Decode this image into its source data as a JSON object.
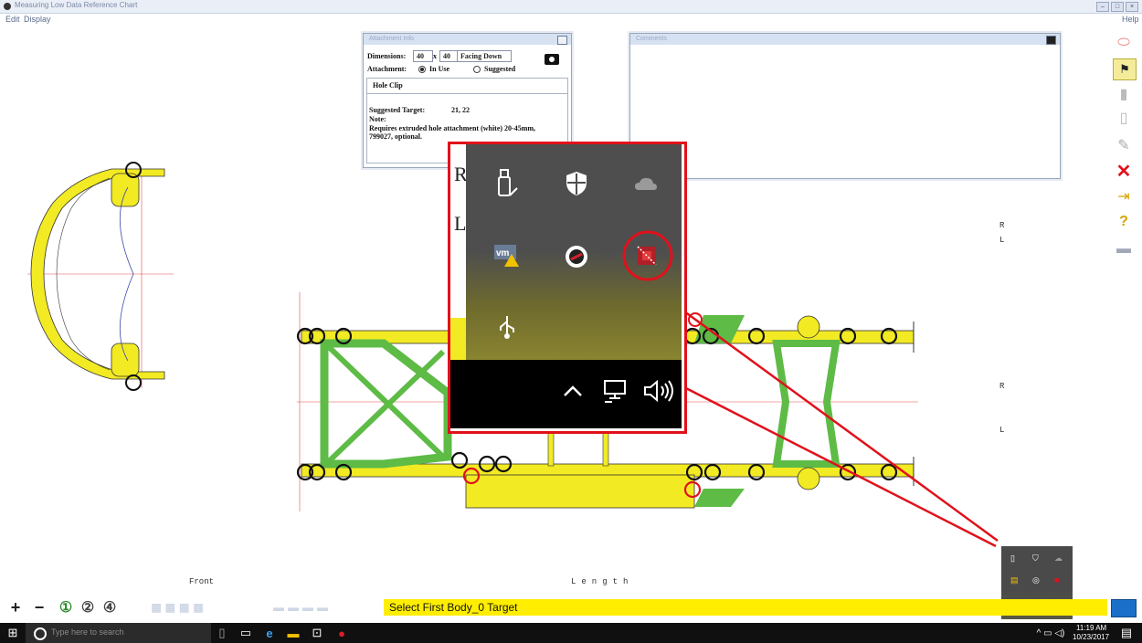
{
  "window": {
    "title": "Measuring Low Data Reference Chart"
  },
  "menu": [
    "Edit",
    "Display"
  ],
  "help_menu": "Help",
  "attachment_panel": {
    "header": "Attachment Info",
    "dimensions_label": "Dimensions:",
    "dim_w": "40",
    "dim_x": "x",
    "dim_h": "40",
    "facing": "Facing Down",
    "attachment_label": "Attachment:",
    "in_use_label": "In Use",
    "suggested_label": "Suggested",
    "item_name": "Hole Clip",
    "suggested_target_label": "Suggested Target:",
    "suggested_target_value": "21, 22",
    "note_label": "Note:",
    "note_text": "Requires extruded hole attachment (white) 20-45mm, 799027, optional."
  },
  "comments_panel": {
    "header": "Comments"
  },
  "side_labels": {
    "r_top": "R",
    "l_top": "L",
    "r_bottom": "R",
    "l_bottom": "L",
    "front": "Front",
    "length": "Length"
  },
  "status": {
    "message": "Select First Body_0 Target"
  },
  "taskbar": {
    "search_placeholder": "Type here to search",
    "time": "11:19 AM",
    "date": "10/23/2017"
  },
  "popup_letters": {
    "a": "R",
    "b": "L"
  },
  "colors": {
    "frame_yellow": "#f2ea23",
    "frame_green": "#5dbb46",
    "highlight_red": "#e1111b",
    "status_yellow": "#ffee00"
  }
}
